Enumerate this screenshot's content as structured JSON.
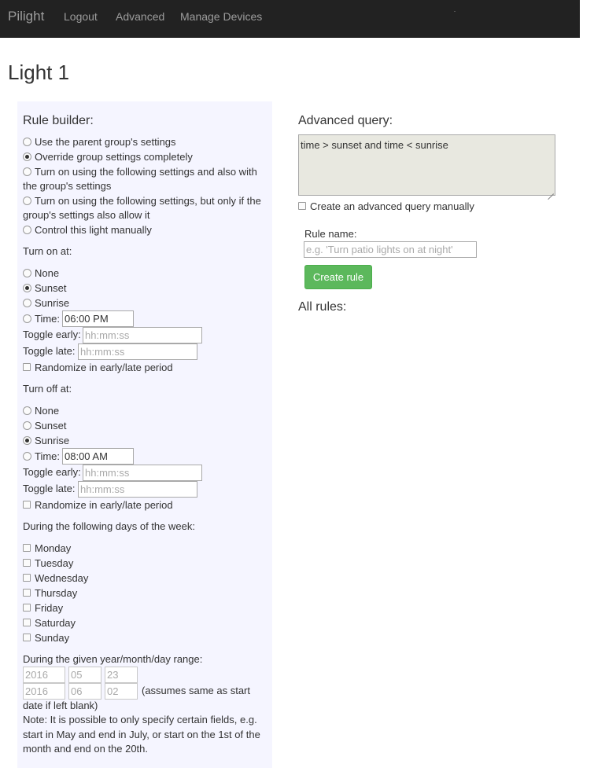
{
  "navbar": {
    "brand": "Pilight",
    "links": [
      "Logout",
      "Advanced",
      "Manage Devices"
    ]
  },
  "page": {
    "title": "Light 1"
  },
  "rule_builder": {
    "title": "Rule builder:",
    "modes": [
      {
        "label": "Use the parent group's settings",
        "checked": false
      },
      {
        "label": "Override group settings completely",
        "checked": true
      },
      {
        "label": [
          "Turn on using the following settings and also with",
          "the group's settings"
        ],
        "checked": false
      },
      {
        "label": [
          "Turn on using the following settings, but only if the",
          "group's settings also allow it"
        ],
        "checked": false
      },
      {
        "label": "Control this light manually",
        "checked": false
      }
    ],
    "turn_on": {
      "heading": "Turn on at:",
      "options": [
        {
          "label": "None",
          "checked": false
        },
        {
          "label": "Sunset",
          "checked": true
        },
        {
          "label": "Sunrise",
          "checked": false
        },
        {
          "label": "Time:",
          "checked": false
        }
      ],
      "time_value": "06:00 PM",
      "toggle_early_label": "Toggle early:",
      "toggle_early_placeholder": "hh:mm:ss",
      "toggle_late_label": "Toggle late:",
      "toggle_late_placeholder": "hh:mm:ss",
      "randomize_label": "Randomize in early/late period"
    },
    "turn_off": {
      "heading": "Turn off at:",
      "options": [
        {
          "label": "None",
          "checked": false
        },
        {
          "label": "Sunset",
          "checked": false
        },
        {
          "label": "Sunrise",
          "checked": true
        },
        {
          "label": "Time:",
          "checked": false
        }
      ],
      "time_value": "08:00 AM",
      "toggle_early_label": "Toggle early:",
      "toggle_early_placeholder": "hh:mm:ss",
      "toggle_late_label": "Toggle late:",
      "toggle_late_placeholder": "hh:mm:ss",
      "randomize_label": "Randomize in early/late period"
    },
    "days": {
      "heading": "During the following days of the week:",
      "items": [
        "Monday",
        "Tuesday",
        "Wednesday",
        "Thursday",
        "Friday",
        "Saturday",
        "Sunday"
      ]
    },
    "date_range": {
      "heading": "During the given year/month/day range:",
      "start": {
        "year": "2016",
        "month": "05",
        "day": "23"
      },
      "end": {
        "year": "2016",
        "month": "06",
        "day": "02"
      },
      "end_hint": [
        "(assumes same as start",
        "date if left blank)"
      ],
      "note": [
        "Note: It is possible to only specify certain fields, e.g.",
        "start in May and end in July, or start on the 1st of the",
        "month and end on the 20th."
      ]
    }
  },
  "advanced": {
    "title": "Advanced query:",
    "query": "time > sunset and time < sunrise",
    "manual_label": "Create an advanced query manually",
    "rule_name_label": "Rule name:",
    "rule_name_placeholder": "e.g. 'Turn patio lights on at night'",
    "create_button": "Create rule",
    "all_rules_title": "All rules:"
  }
}
